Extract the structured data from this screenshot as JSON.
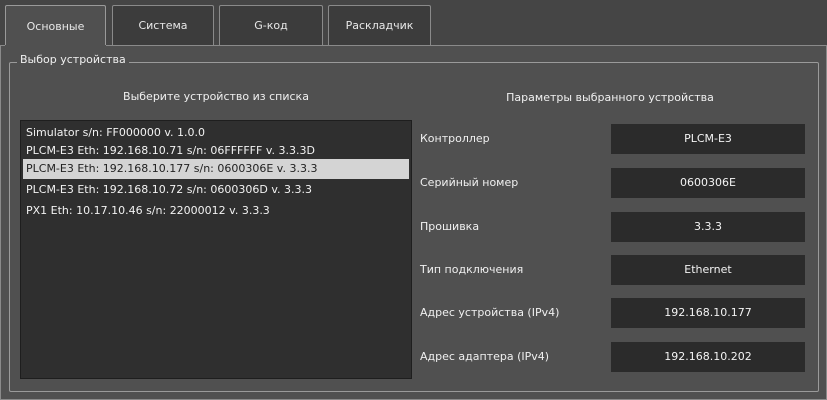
{
  "tabs": [
    {
      "label": "Основные",
      "active": true
    },
    {
      "label": "Система",
      "active": false
    },
    {
      "label": "G-код",
      "active": false
    },
    {
      "label": "Раскладчик",
      "active": false
    }
  ],
  "group": {
    "title": "Выбор устройства"
  },
  "left_column": {
    "title": "Выберите устройство из списка"
  },
  "right_column": {
    "title": "Параметры выбранного устройства"
  },
  "devices": [
    {
      "text": "Simulator s/n: FF000000 v. 1.0.0",
      "selected": false
    },
    {
      "text": "PLCM-E3 Eth: 192.168.10.71 s/n: 06FFFFFF v. 3.3.3D",
      "selected": false
    },
    {
      "text": "PLCM-E3 Eth: 192.168.10.177 s/n: 0600306E v. 3.3.3",
      "selected": true
    },
    {
      "text": "PLCM-E3 Eth: 192.168.10.72 s/n: 0600306D v. 3.3.3",
      "selected": false
    },
    {
      "text": "PX1 Eth: 10.17.10.46 s/n: 22000012 v. 3.3.3",
      "selected": false
    }
  ],
  "params": [
    {
      "label": "Контроллер",
      "value": "PLCM-E3"
    },
    {
      "label": "Серийный номер",
      "value": "0600306E"
    },
    {
      "label": "Прошивка",
      "value": "3.3.3"
    },
    {
      "label": "Тип подключения",
      "value": "Ethernet"
    },
    {
      "label": "Адрес устройства (IPv4)",
      "value": "192.168.10.177"
    },
    {
      "label": "Адрес адаптера (IPv4)",
      "value": "192.168.10.202"
    }
  ]
}
